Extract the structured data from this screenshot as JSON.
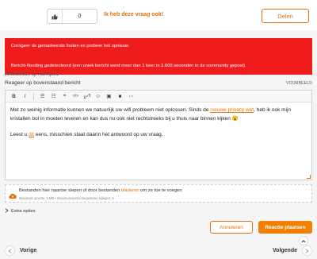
{
  "top": {
    "like_count": "0",
    "me_too_label": "Ik heb deze vraag ook!",
    "share_label": "Delen"
  },
  "errors": {
    "main": "Corrigeer de gemarkeerde fouten en probeer het opnieuw.",
    "flood": "Bericht-flooding gedetecteerd (een uniek bericht werd meer dan 1 keer in 3.600 seconden in de community gepost)"
  },
  "reply": {
    "reply_to": "Antwoorden op Harmpie1",
    "title": "Reageer op bovenstaand bericht",
    "preview": "VOORBEELD"
  },
  "toolbar": {
    "bold": "B",
    "italic": "I",
    "bullets": "☰",
    "numbered": "☷",
    "quote": "❝",
    "code": "</>",
    "link": "🔗",
    "emoji": "☺",
    "image": "▣",
    "video": "■",
    "more": "⋯"
  },
  "editor": {
    "para1_before": "Met zo weinig informatie kunnen we natuurlijk uw wifi probleem niet oplossen. Sinds de ",
    "para1_link": "nieuwe privacy wet",
    "para1_after": ", heb ik ook mijn kristallen bol in moeten leveren en kan dus nu ook niet rechtstreeks bij u thuis naar binnen kijken ",
    "para1_emoji": "😮",
    "para2_before": "Leest u ",
    "para2_link": "dit",
    "para2_after": " eens, misschien staat daarin het antwoord op uw vraag."
  },
  "upload": {
    "main_before": "Bestanden hier naartoe slepen of door bestanden ",
    "browse": "bladeren",
    "main_after": " om ze toe te voegen",
    "sub": "Maximale grootte: 5 MB • Maximumaantal toegestane bijlagen: 5"
  },
  "extra_options": "Extra opties",
  "actions": {
    "cancel": "Annuleren",
    "submit": "Reactie plaatsen"
  },
  "pagination": {
    "prev": "Vorige",
    "next": "Volgende"
  },
  "colors": {
    "accent": "#e0730a",
    "error_bg": "#ee1c1c"
  }
}
